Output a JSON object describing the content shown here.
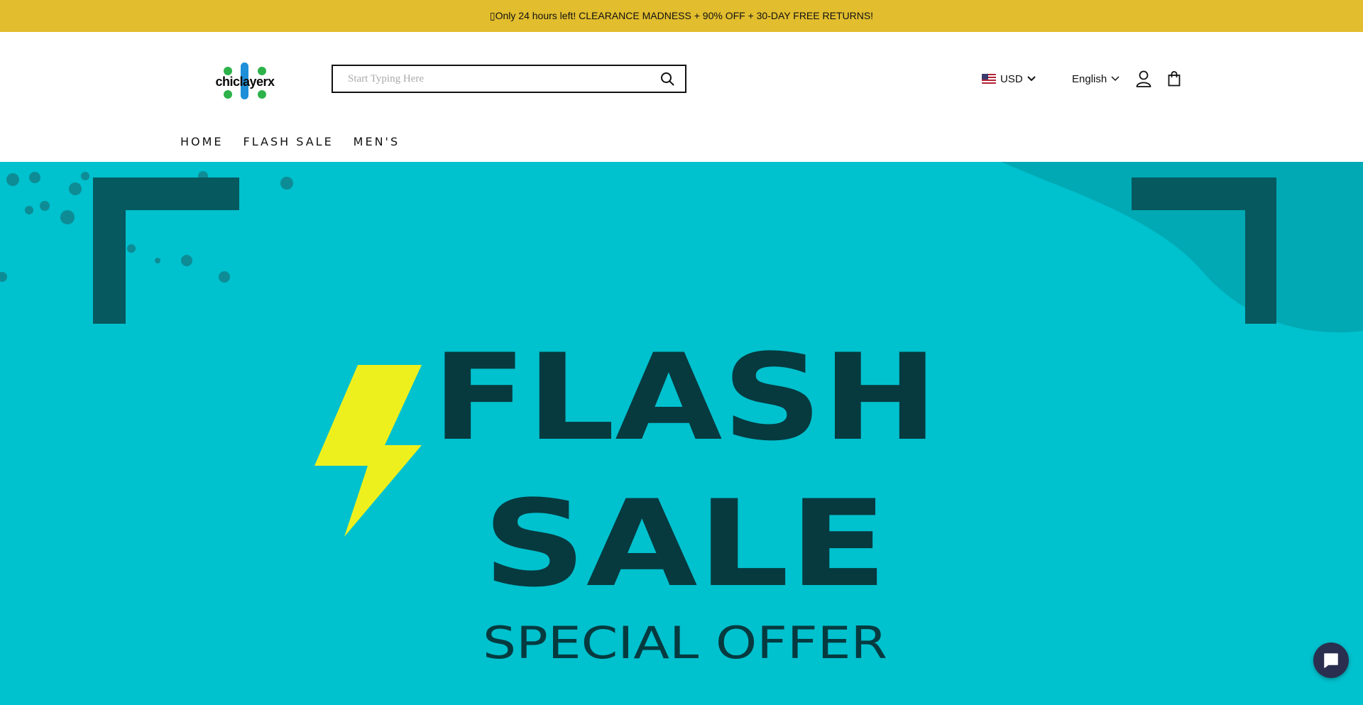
{
  "announcement": {
    "text": "▯Only 24 hours left! CLEARANCE MADNESS + 90% OFF + 30-DAY FREE RETURNS!"
  },
  "logo": {
    "text": "chiclayerx",
    "colors": {
      "dots": "#2DB24A",
      "bar": "#1E8FD8"
    }
  },
  "search": {
    "placeholder": "Start Typing Here",
    "value": "",
    "icon": "search-icon"
  },
  "currency": {
    "selected": "USD",
    "flag_icon": "us-flag-icon"
  },
  "language": {
    "selected": "English"
  },
  "header_icons": [
    "user-icon",
    "shopping-bag-icon"
  ],
  "nav": {
    "items": [
      {
        "label": "HOME"
      },
      {
        "label": "FLASH SALE"
      },
      {
        "label": "MEN'S"
      }
    ]
  },
  "hero": {
    "line1": "FLASH",
    "line2": "SALE",
    "line3": "SPECIAL OFFER",
    "colors": {
      "background": "#00C1CE",
      "text": "#063A3F",
      "bracket": "#06595F",
      "bolt": "#EEF01E"
    }
  },
  "colors": {
    "announcement_bg": "#E2BD2E",
    "chat_button": "#2B2F4F"
  },
  "chat": {
    "icon": "chat-bubble-icon"
  }
}
